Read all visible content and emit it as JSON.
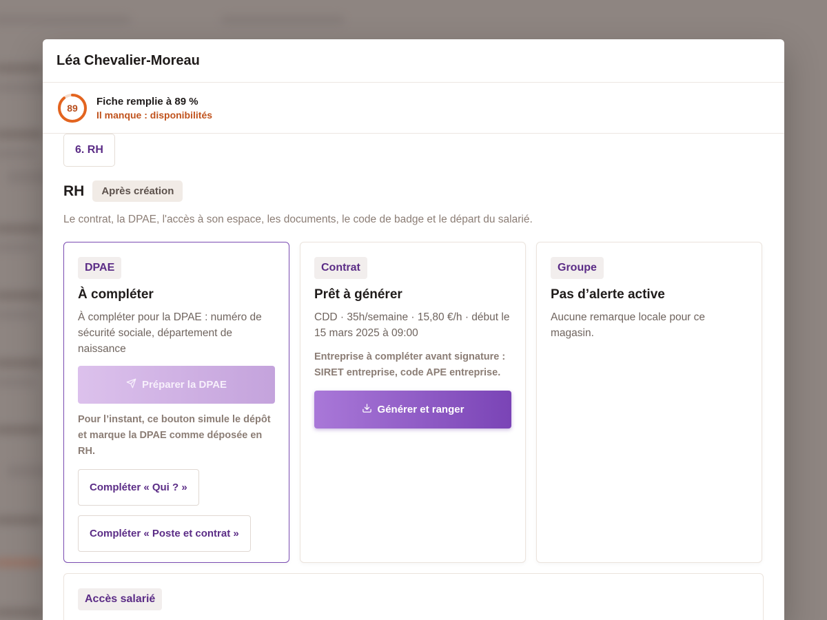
{
  "modal": {
    "title": "Léa Chevalier-Moreau"
  },
  "completion": {
    "percent": 89,
    "label": "Fiche remplie à 89 %",
    "missing": "Il manque : disponibilités",
    "ring_color": "#e3641f",
    "ring_track": "#f5dccc"
  },
  "step_tab": {
    "label": "6. RH"
  },
  "section": {
    "title": "RH",
    "badge": "Après création",
    "description": "Le contrat, la DPAE, l'accès à son espace, les documents, le code de badge et le départ du salarié."
  },
  "cards": {
    "dpae": {
      "chip": "DPAE",
      "title": "À compléter",
      "body": "À compléter pour la DPAE : numéro de sécurité sociale, département de naissance",
      "button": "Préparer la DPAE",
      "button_icon": "send-icon",
      "note": "Pour l’instant, ce bouton simule le dépôt et marque la DPAE comme déposée en RH.",
      "link_who": "Compléter « Qui ? »",
      "link_contract": "Compléter « Poste et contrat »"
    },
    "contract": {
      "chip": "Contrat",
      "title": "Prêt à générer",
      "body": "CDD · 35h/semaine · 15,80 €/h · début le 15 mars 2025 à 09:00",
      "note": "Entreprise à compléter avant signature : SIRET entreprise, code APE entreprise.",
      "button": "Générer et ranger",
      "button_icon": "download-icon"
    },
    "group": {
      "chip": "Groupe",
      "title": "Pas d’alerte active",
      "body": "Aucune remarque locale pour ce magasin."
    }
  },
  "access": {
    "chip": "Accès salarié"
  },
  "colors": {
    "accent": "#5b2c86",
    "primary_button": "#8b55c6",
    "warning": "#c0521c"
  }
}
